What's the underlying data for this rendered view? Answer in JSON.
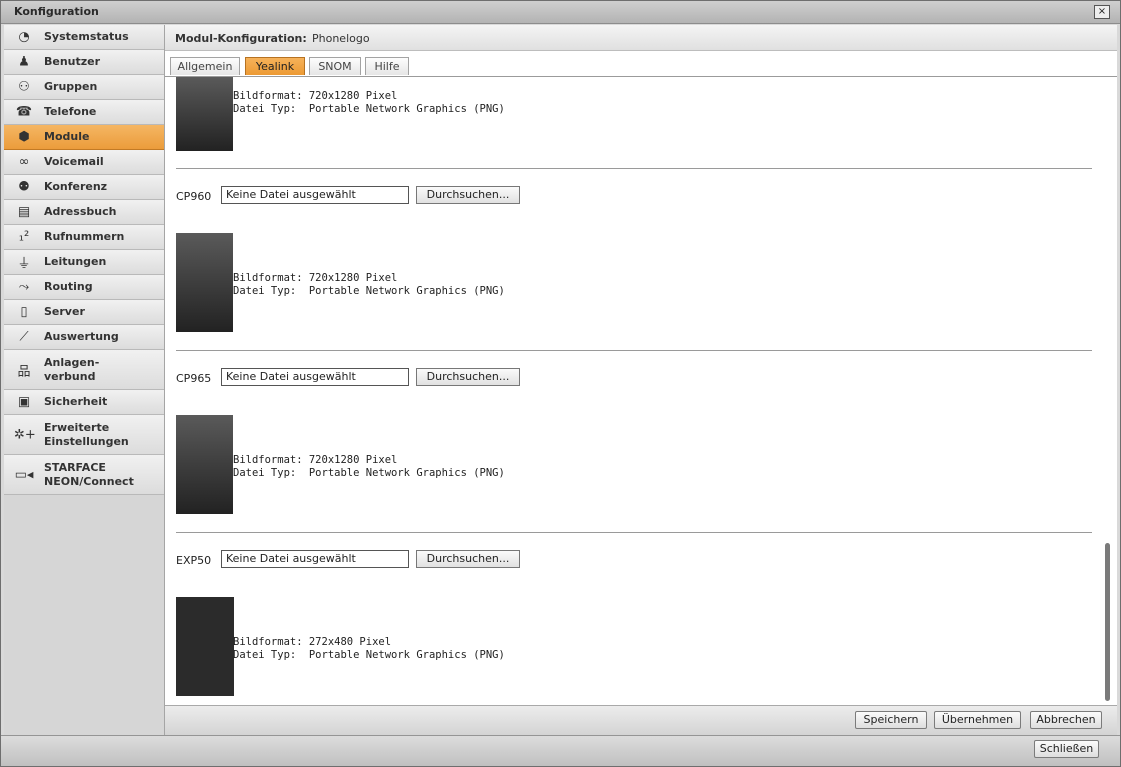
{
  "window": {
    "title": "Konfiguration",
    "close_glyph": "×"
  },
  "sidebar": {
    "items": [
      {
        "label": "Systemstatus",
        "icon": "dashboard-icon",
        "glyph": "◔"
      },
      {
        "label": "Benutzer",
        "icon": "user-icon",
        "glyph": "♟"
      },
      {
        "label": "Gruppen",
        "icon": "group-icon",
        "glyph": "⚇"
      },
      {
        "label": "Telefone",
        "icon": "telephone-icon",
        "glyph": "☎"
      },
      {
        "label": "Module",
        "icon": "module-icon",
        "glyph": "⬢",
        "active": true
      },
      {
        "label": "Voicemail",
        "icon": "voicemail-icon",
        "glyph": "∞"
      },
      {
        "label": "Konferenz",
        "icon": "conference-icon",
        "glyph": "⚉"
      },
      {
        "label": "Adressbuch",
        "icon": "addressbook-icon",
        "glyph": "▤"
      },
      {
        "label": "Rufnummern",
        "icon": "numbers-icon",
        "glyph": "₁²"
      },
      {
        "label": "Leitungen",
        "icon": "plug-icon",
        "glyph": "⏚"
      },
      {
        "label": "Routing",
        "icon": "routing-icon",
        "glyph": "⤳"
      },
      {
        "label": "Server",
        "icon": "server-icon",
        "glyph": "▯"
      },
      {
        "label": "Auswertung",
        "icon": "chart-icon",
        "glyph": "⟋"
      },
      {
        "label": "Anlagen-\nverbund",
        "icon": "network-icon",
        "glyph": "品"
      },
      {
        "label": "Sicherheit",
        "icon": "lock-icon",
        "glyph": "▣"
      },
      {
        "label": "Erweiterte\nEinstellungen",
        "icon": "settings-plus-icon",
        "glyph": "✲+"
      },
      {
        "label": "STARFACE\nNEON/Connect",
        "icon": "video-camera-icon",
        "glyph": "▭◂"
      }
    ]
  },
  "header": {
    "label": "Modul-Konfiguration:",
    "value": "Phonelogo"
  },
  "tabs": [
    {
      "label": "Allgemein"
    },
    {
      "label": "Yealink",
      "active": true
    },
    {
      "label": "SNOM"
    },
    {
      "label": "Hilfe"
    }
  ],
  "content": {
    "top_info": {
      "format": "Bildformat: 720x1280 Pixel",
      "type": "Datei Typ:  Portable Network Graphics (PNG)"
    },
    "entries": [
      {
        "model": "CP960",
        "file_value": "Keine Datei ausgewählt",
        "browse": "Durchsuchen...",
        "format": "Bildformat: 720x1280 Pixel",
        "type": "Datei Typ:  Portable Network Graphics (PNG)"
      },
      {
        "model": "CP965",
        "file_value": "Keine Datei ausgewählt",
        "browse": "Durchsuchen...",
        "format": "Bildformat: 720x1280 Pixel",
        "type": "Datei Typ:  Portable Network Graphics (PNG)"
      },
      {
        "model": "EXP50",
        "file_value": "Keine Datei ausgewählt",
        "browse": "Durchsuchen...",
        "format": "Bildformat: 272x480 Pixel",
        "type": "Datei Typ:  Portable Network Graphics (PNG)"
      }
    ]
  },
  "footer": {
    "save": "Speichern",
    "apply": "Übernehmen",
    "cancel": "Abbrechen"
  },
  "bottom": {
    "close": "Schließen"
  }
}
